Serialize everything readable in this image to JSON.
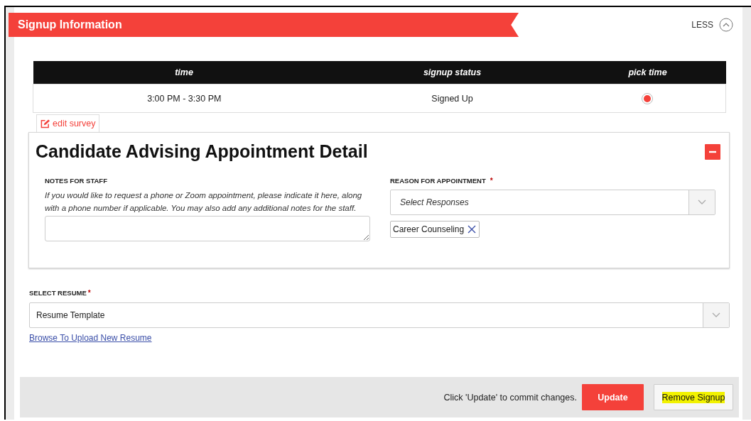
{
  "header": {
    "title": "Signup Information",
    "toggle_label": "LESS",
    "expanded": true
  },
  "table": {
    "columns": [
      "time",
      "signup status",
      "pick time"
    ],
    "rows": [
      {
        "time": "3:00 PM - 3:30 PM",
        "status": "Signed Up",
        "selected": true
      }
    ]
  },
  "edit_survey": "edit survey",
  "detail": {
    "title": "Candidate Advising Appointment Detail",
    "expanded": true,
    "notes": {
      "label": "NOTES FOR STAFF",
      "help": "If you would like to request a phone or Zoom appointment, please indicate it here, along with a phone number if applicable. You may also add any additional notes for the staff."
    },
    "reason": {
      "label": "REASON FOR APPOINTMENT",
      "required_mark": "*",
      "placeholder": "Select Responses",
      "tags": [
        "Career Counseling"
      ]
    }
  },
  "resume": {
    "label": "SELECT RESUME",
    "required_mark": "*",
    "value": "Resume Template",
    "link": "Browse To Upload New Resume"
  },
  "footer": {
    "hint": "Click 'Update' to commit changes.",
    "buttons": [
      {
        "label": "Update",
        "kind": "primary",
        "highlighted": false
      },
      {
        "label": "Remove Signup",
        "kind": "secondary",
        "highlighted": true
      }
    ]
  }
}
